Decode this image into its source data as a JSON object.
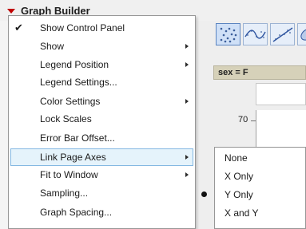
{
  "window": {
    "title": "Graph Builder"
  },
  "group_header": {
    "label": "sex = F"
  },
  "axis": {
    "y_tick": "70"
  },
  "main_menu": {
    "items": [
      {
        "label": "Show Control Panel",
        "checked": true,
        "submenu": false
      },
      {
        "label": "Show",
        "checked": false,
        "submenu": true
      },
      {
        "label": "Legend Position",
        "checked": false,
        "submenu": true
      },
      {
        "label": "Legend Settings...",
        "checked": false,
        "submenu": false
      },
      {
        "label": "Color Settings",
        "checked": false,
        "submenu": true
      },
      {
        "label": "Lock Scales",
        "checked": false,
        "submenu": false
      },
      {
        "label": "Error Bar Offset...",
        "checked": false,
        "submenu": false
      },
      {
        "label": "Link Page Axes",
        "checked": false,
        "submenu": true,
        "highlighted": true
      },
      {
        "label": "Fit to Window",
        "checked": false,
        "submenu": true
      },
      {
        "label": "Sampling...",
        "checked": false,
        "submenu": false
      },
      {
        "label": "Graph Spacing...",
        "checked": false,
        "submenu": false
      }
    ]
  },
  "link_page_axes_submenu": {
    "items": [
      {
        "label": "None",
        "selected": false
      },
      {
        "label": "X Only",
        "selected": false
      },
      {
        "label": "Y Only",
        "selected": true
      },
      {
        "label": "X and Y",
        "selected": false
      }
    ]
  },
  "colors": {
    "highlight_bg": "#e5f3fb",
    "highlight_border": "#84b8e2",
    "title_triangle": "#c00000",
    "group_header_bg": "#d6d1b9"
  }
}
